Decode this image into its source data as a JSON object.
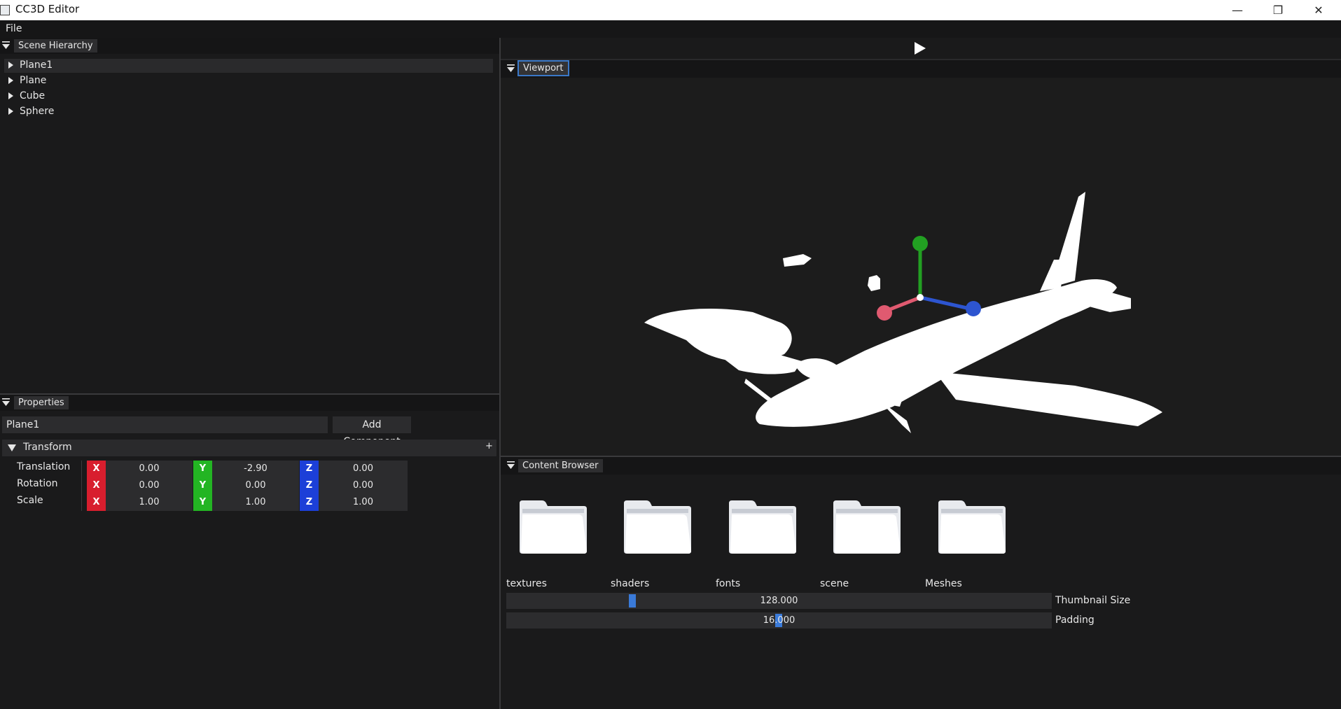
{
  "window": {
    "title": "CC3D Editor",
    "minimize_glyph": "—",
    "maximize_glyph": "❐",
    "close_glyph": "✕"
  },
  "menubar": {
    "items": [
      {
        "label": "File"
      }
    ]
  },
  "toolbar": {
    "play_icon": "play-icon"
  },
  "scene_hierarchy": {
    "tab_label": "Scene Hierarchy",
    "items": [
      {
        "label": "Plane1",
        "selected": true
      },
      {
        "label": "Plane",
        "selected": false
      },
      {
        "label": "Cube",
        "selected": false
      },
      {
        "label": "Sphere",
        "selected": false
      }
    ]
  },
  "properties": {
    "tab_label": "Properties",
    "entity_name": "Plane1",
    "add_component_label": "Add Component",
    "transform": {
      "header": "Transform",
      "plus": "+",
      "rows": [
        {
          "label": "Translation",
          "x": "0.00",
          "y": "-2.90",
          "z": "0.00"
        },
        {
          "label": "Rotation",
          "x": "0.00",
          "y": "0.00",
          "z": "0.00"
        },
        {
          "label": "Scale",
          "x": "1.00",
          "y": "1.00",
          "z": "1.00"
        }
      ],
      "axis_labels": {
        "x": "X",
        "y": "Y",
        "z": "Z"
      }
    }
  },
  "viewport": {
    "tab_label": "Viewport"
  },
  "content_browser": {
    "tab_label": "Content Browser",
    "folders": [
      {
        "label": "textures"
      },
      {
        "label": "shaders"
      },
      {
        "label": "fonts"
      },
      {
        "label": "scene"
      },
      {
        "label": "Meshes"
      }
    ],
    "thumbnail_size": {
      "value": "128.000",
      "label": "Thumbnail Size"
    },
    "padding": {
      "value": "16.000",
      "label": "Padding"
    }
  },
  "colors": {
    "axis_x": "#d81e2e",
    "axis_y": "#23b523",
    "axis_z": "#1c3fd8",
    "accent": "#3a78c8",
    "gizmo_x": "#e05a70",
    "gizmo_y": "#22a022",
    "gizmo_z": "#2d55d0"
  }
}
